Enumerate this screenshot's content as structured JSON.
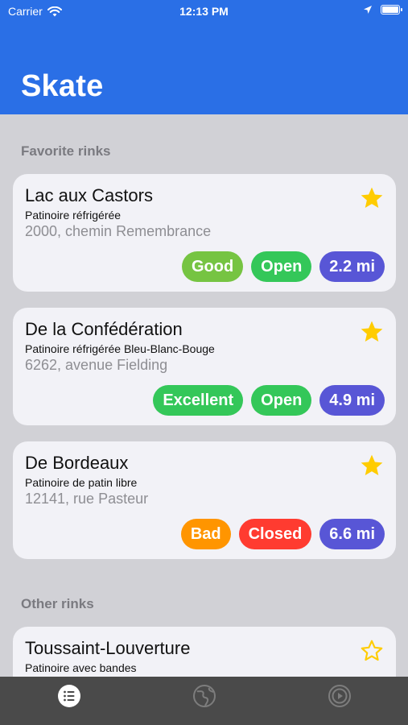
{
  "status": {
    "carrier": "Carrier",
    "time": "12:13 PM"
  },
  "app": {
    "title": "Skate"
  },
  "sections": {
    "favorites": "Favorite rinks",
    "others": "Other rinks"
  },
  "rinks": [
    {
      "name": "Lac aux Castors",
      "type": "Patinoire réfrigérée",
      "address": "2000, chemin Remembrance",
      "favorite": true,
      "condition": "Good",
      "status": "Open",
      "distance": "2.2 mi"
    },
    {
      "name": "De la Confédération",
      "type": "Patinoire réfrigérée Bleu-Blanc-Bouge",
      "address": "6262, avenue Fielding",
      "favorite": true,
      "condition": "Excellent",
      "status": "Open",
      "distance": "4.9 mi"
    },
    {
      "name": "De Bordeaux",
      "type": "Patinoire de patin libre",
      "address": "12141, rue Pasteur",
      "favorite": true,
      "condition": "Bad",
      "status": "Closed",
      "distance": "6.6 mi"
    },
    {
      "name": "Toussaint-Louverture",
      "type": "Patinoire avec bandes",
      "favorite": false
    }
  ],
  "colors": {
    "header": "#2a6fe6",
    "good": "#76c442",
    "open": "#34c759",
    "excellent": "#34c759",
    "bad": "#ff9500",
    "closed": "#ff3b30",
    "distance": "#5856d6",
    "star": "#ffcc00"
  },
  "tabs": [
    {
      "icon": "list-icon",
      "active": true
    },
    {
      "icon": "map-globe-icon",
      "active": false
    },
    {
      "icon": "play-circle-icon",
      "active": false
    }
  ]
}
